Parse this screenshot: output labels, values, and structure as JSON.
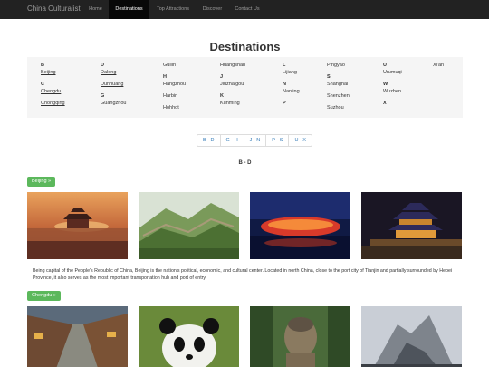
{
  "nav": {
    "brand": "China Culturalist",
    "items": [
      {
        "label": "Home",
        "active": false
      },
      {
        "label": "Destinations",
        "active": true
      },
      {
        "label": "Top Attractions",
        "active": false
      },
      {
        "label": "Discover",
        "active": false
      },
      {
        "label": "Contact Us",
        "active": false
      }
    ]
  },
  "page_title": "Destinations",
  "index": {
    "letters": {
      "b": "B",
      "c": "C",
      "d": "D",
      "g": "G",
      "h": "H",
      "j": "J",
      "k": "K",
      "l": "L",
      "n": "N",
      "p": "P",
      "s": "S",
      "u": "U",
      "w": "W",
      "x": "X"
    },
    "cities": {
      "beijing": "Beijing",
      "chengdu": "Chengdu",
      "chongqing": "Chongqing",
      "dalong": "Dalong",
      "dunhuang": "Dunhuang",
      "guangzhou": "Guangzhou",
      "guilin": "Guilin",
      "hangzhou": "Hangzhou",
      "harbin": "Harbin",
      "hohhot": "Hohhot",
      "huangshan": "Huangshan",
      "jiuzhaigou": "Jiuzhaigou",
      "kunming": "Kunming",
      "lijiang": "Lijiang",
      "nanjing": "Nanjing",
      "pingyao": "Pingyao",
      "shanghai": "Shanghai",
      "shenzhen": "Shenzhen",
      "suzhou": "Suzhou",
      "urumuqi": "Urumuqi",
      "wuzhen": "Wuzhen",
      "xian": "Xi'an"
    }
  },
  "range_nav": [
    "B - D",
    "G - H",
    "J - N",
    "P - S",
    "U - X"
  ],
  "section_heading": "B - D",
  "beijing": {
    "button": "Beijing »",
    "description": "Being capital of the People's Republic of China, Beijing is the nation's political, economic, and cultural center. Located in north China, close to the port city of Tianjin and partially surrounded by Hebei Province, it also serves as the most important transportation hub and port of entry."
  },
  "chengdu": {
    "button": "Chengdu »"
  },
  "colors": {
    "navbar": "#222222",
    "button_green": "#5cb85c",
    "link_blue": "#337ab7"
  }
}
